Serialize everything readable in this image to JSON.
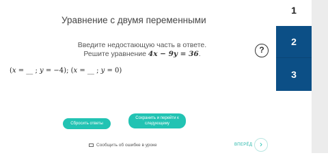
{
  "title": "Уравнение с двумя переменными",
  "instructions": {
    "line1": "Введите недостающую часть в ответе.",
    "line2": "Решите уравнение",
    "equation": "4x − 9y = 36",
    "end": "."
  },
  "answer": {
    "p1_open": "(",
    "x1_label": "x",
    "eq1": " = ",
    "blank1": "__",
    "sep1": " ; ",
    "y1_label": "y",
    "eq2": " = −4); (",
    "x2_label": "x",
    "eq3": " = ",
    "blank2": "__",
    "sep2": " ; ",
    "y2_label": "y",
    "eq4": " = 0)"
  },
  "help_icon": "?",
  "buttons": {
    "reset": "Сбросить ответы",
    "save_line1": "Сохранить и перейти к",
    "save_line2": "следующему"
  },
  "report": "Сообщить об ошибке в уроке",
  "next": {
    "label": "ВПЕРЁД",
    "icon": "›"
  },
  "steps": [
    "1",
    "2",
    "3"
  ],
  "colors": {
    "accent": "#22c3b3",
    "step_active": "#0c4f86"
  }
}
